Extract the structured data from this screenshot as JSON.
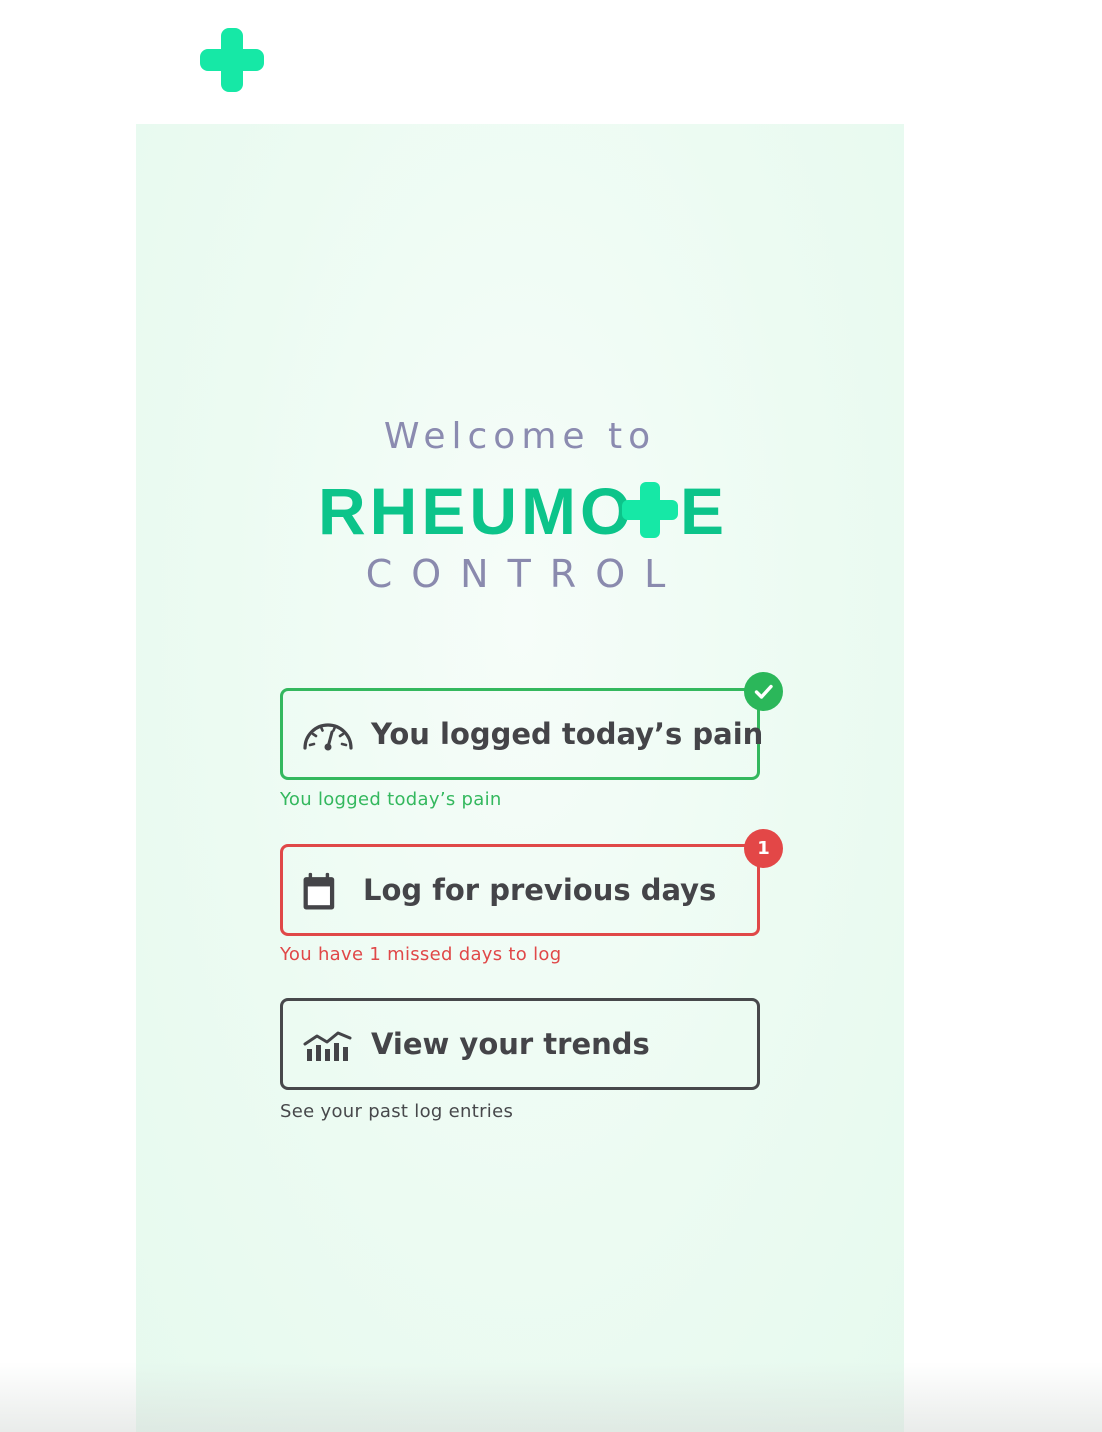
{
  "brand": {
    "welcome_text": "Welcome to",
    "logo_word_left": "RHEUMO",
    "logo_word_right": "E",
    "logo_subtitle": "CONTROL"
  },
  "icons": {
    "corner": "plus-cross-icon",
    "pain": "speedometer-icon",
    "previous": "calendar-icon",
    "trends": "bar-chart-trend-icon",
    "done_badge": "checkmark-icon"
  },
  "actions": {
    "pain": {
      "label": "You logged today’s pain",
      "caption": "You logged today’s pain",
      "status": "done"
    },
    "previous": {
      "label": "Log for previous days",
      "caption": "You have 1 missed days to log",
      "badge_count": "1"
    },
    "trends": {
      "label": "View your trends",
      "caption": "See your past log entries"
    }
  },
  "colors": {
    "brand_green": "#0cc48a",
    "plus_mint": "#16e8a6",
    "success": "#34b85e",
    "alert": "#e04848",
    "neutral": "#47484b",
    "subtitle": "#8b8bb0",
    "panel_bg": "#ecfbf2"
  }
}
